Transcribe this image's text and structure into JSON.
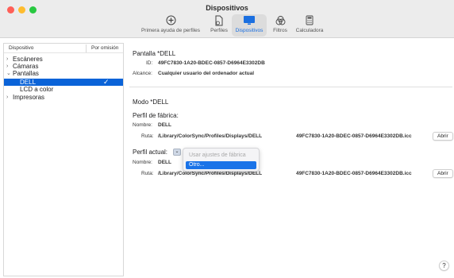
{
  "window": {
    "title": "Dispositivos"
  },
  "toolbar": {
    "items": [
      {
        "label": "Primera ayuda de perfiles",
        "icon": "stethoscope-plus-icon"
      },
      {
        "label": "Perfiles",
        "icon": "profile-document-icon"
      },
      {
        "label": "Dispositivos",
        "icon": "display-icon",
        "active": true
      },
      {
        "label": "Filtros",
        "icon": "filter-icon"
      },
      {
        "label": "Calculadora",
        "icon": "calculator-icon"
      }
    ]
  },
  "sidebar": {
    "col_device": "Dispositivo",
    "col_default": "Por omisión",
    "items": [
      {
        "label": "Escáneres",
        "expanded": false
      },
      {
        "label": "Cámaras",
        "expanded": false
      },
      {
        "label": "Pantallas",
        "expanded": true
      },
      {
        "label": "DELL",
        "selected": true,
        "default": true
      },
      {
        "label": "LCD a color"
      },
      {
        "label": "Impresoras",
        "expanded": false
      }
    ]
  },
  "device": {
    "heading": "Pantalla *DELL",
    "id_label": "ID:",
    "id_value": "49FC7830-1A20-BDEC-0857-D6964E3302DB",
    "scope_label": "Alcance:",
    "scope_value": "Cualquier usuario del ordenador actual"
  },
  "mode": {
    "label": "Modo *DELL"
  },
  "factory_profile": {
    "heading": "Perfil de fábrica:",
    "name_label": "Nombre:",
    "name_value": "DELL",
    "path_label": "Ruta:",
    "path_value": "/Library/ColorSync/Profiles/Displays/DELL",
    "file_value": "49FC7830-1A20-BDEC-0857-D6964E3302DB.icc",
    "open_button": "Abrir"
  },
  "current_profile": {
    "heading": "Perfil actual:",
    "name_label": "Nombre:",
    "name_value": "DELL",
    "path_label": "Ruta:",
    "path_value": "/Library/ColorSync/Profiles/Displays/DELL",
    "file_value": "49FC7830-1A20-BDEC-0857-D6964E3302DB.icc",
    "open_button": "Abrir"
  },
  "popup_menu": {
    "items": [
      {
        "label": "Usar ajustes de fábrica",
        "disabled": true
      },
      {
        "label": "Otro...",
        "highlighted": true
      }
    ]
  },
  "help": {
    "label": "?"
  },
  "colors": {
    "accent": "#0a63d8",
    "highlight": "#1a73e8"
  }
}
